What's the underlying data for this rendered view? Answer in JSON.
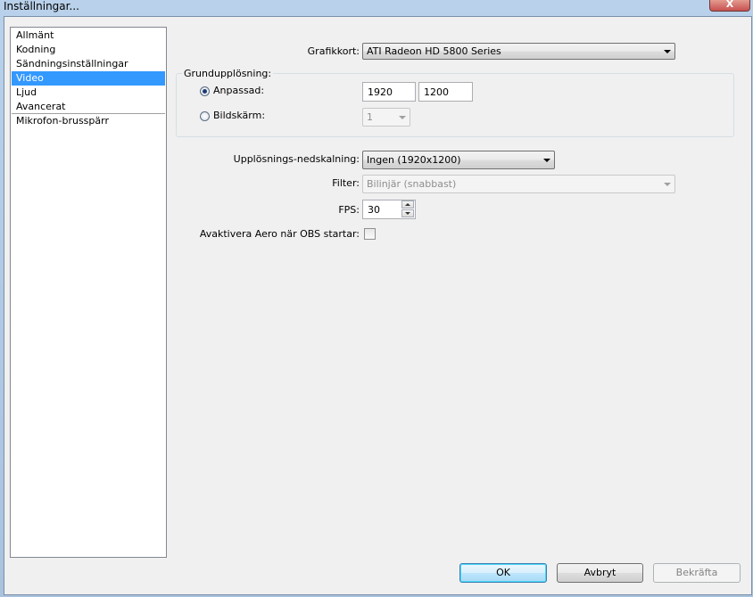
{
  "window": {
    "title": "Inställningar...",
    "close_label": "X"
  },
  "nav": {
    "items": [
      {
        "label": "Allmänt",
        "selected": false
      },
      {
        "label": "Kodning",
        "selected": false
      },
      {
        "label": "Sändningsinställningar",
        "selected": false
      },
      {
        "label": "Video",
        "selected": true
      },
      {
        "label": "Ljud",
        "selected": false
      },
      {
        "label": "Avancerat",
        "selected": false
      },
      {
        "label": "Mikrofon-brusspärr",
        "selected": false
      }
    ]
  },
  "video": {
    "graphics_card_label": "Grafikkort:",
    "graphics_card_value": "ATI Radeon HD 5800 Series",
    "base_resolution_group": "Grundupplösning:",
    "custom_label": "Anpassad:",
    "custom_checked": true,
    "width_value": "1920",
    "height_value": "1200",
    "monitor_label": "Bildskärm:",
    "monitor_value": "1",
    "downscale_label": "Upplösnings-nedskalning:",
    "downscale_value": "Ingen  (1920x1200)",
    "filter_label": "Filter:",
    "filter_value": "Bilinjär (snabbast)",
    "fps_label": "FPS:",
    "fps_value": "30",
    "aero_label": "Avaktivera Aero när OBS startar:",
    "aero_checked": false
  },
  "buttons": {
    "ok": "OK",
    "cancel": "Avbryt",
    "apply": "Bekräfta"
  },
  "colors": {
    "selection": "#3399ff",
    "dialog_bg": "#f0f0f0"
  }
}
